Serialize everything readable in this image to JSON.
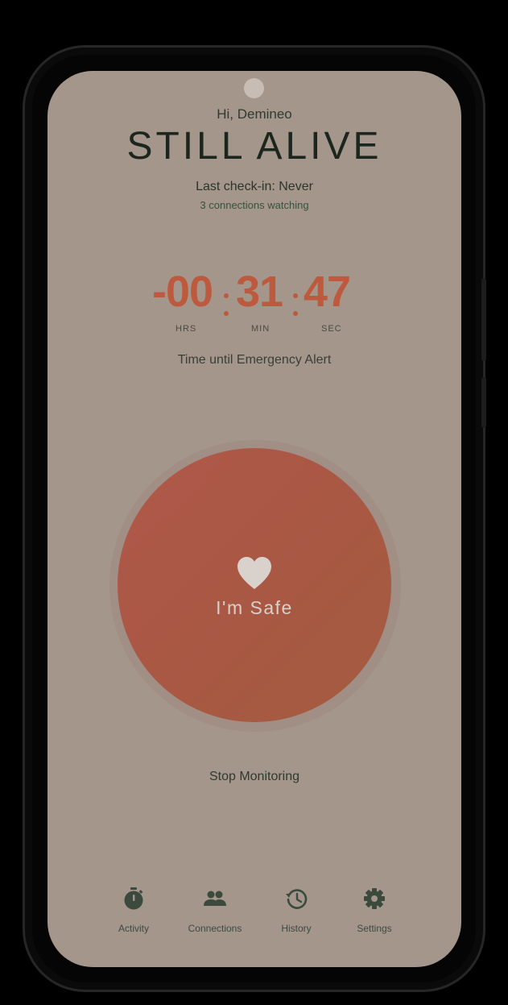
{
  "header": {
    "greeting": "Hi, Demineo",
    "app_title": "STILL ALIVE",
    "last_checkin": "Last check-in: Never",
    "connections_watching": "3 connections watching"
  },
  "countdown": {
    "hours": "-00",
    "minutes": "31",
    "seconds": "47",
    "hours_label": "HRS",
    "minutes_label": "MIN",
    "seconds_label": "SEC",
    "caption": "Time until Emergency Alert"
  },
  "safe_button": {
    "label": "I'm Safe",
    "icon": "heart-icon"
  },
  "stop_monitoring": "Stop Monitoring",
  "nav": {
    "items": [
      {
        "label": "Activity",
        "icon": "stopwatch-icon"
      },
      {
        "label": "Connections",
        "icon": "people-icon"
      },
      {
        "label": "History",
        "icon": "history-icon"
      },
      {
        "label": "Settings",
        "icon": "gear-icon"
      }
    ]
  },
  "colors": {
    "background": "#a4968b",
    "accent": "#bd5a3e",
    "button": "#aa5844",
    "text_dark": "#1c261e",
    "nav_icon": "#3c4a3e"
  }
}
